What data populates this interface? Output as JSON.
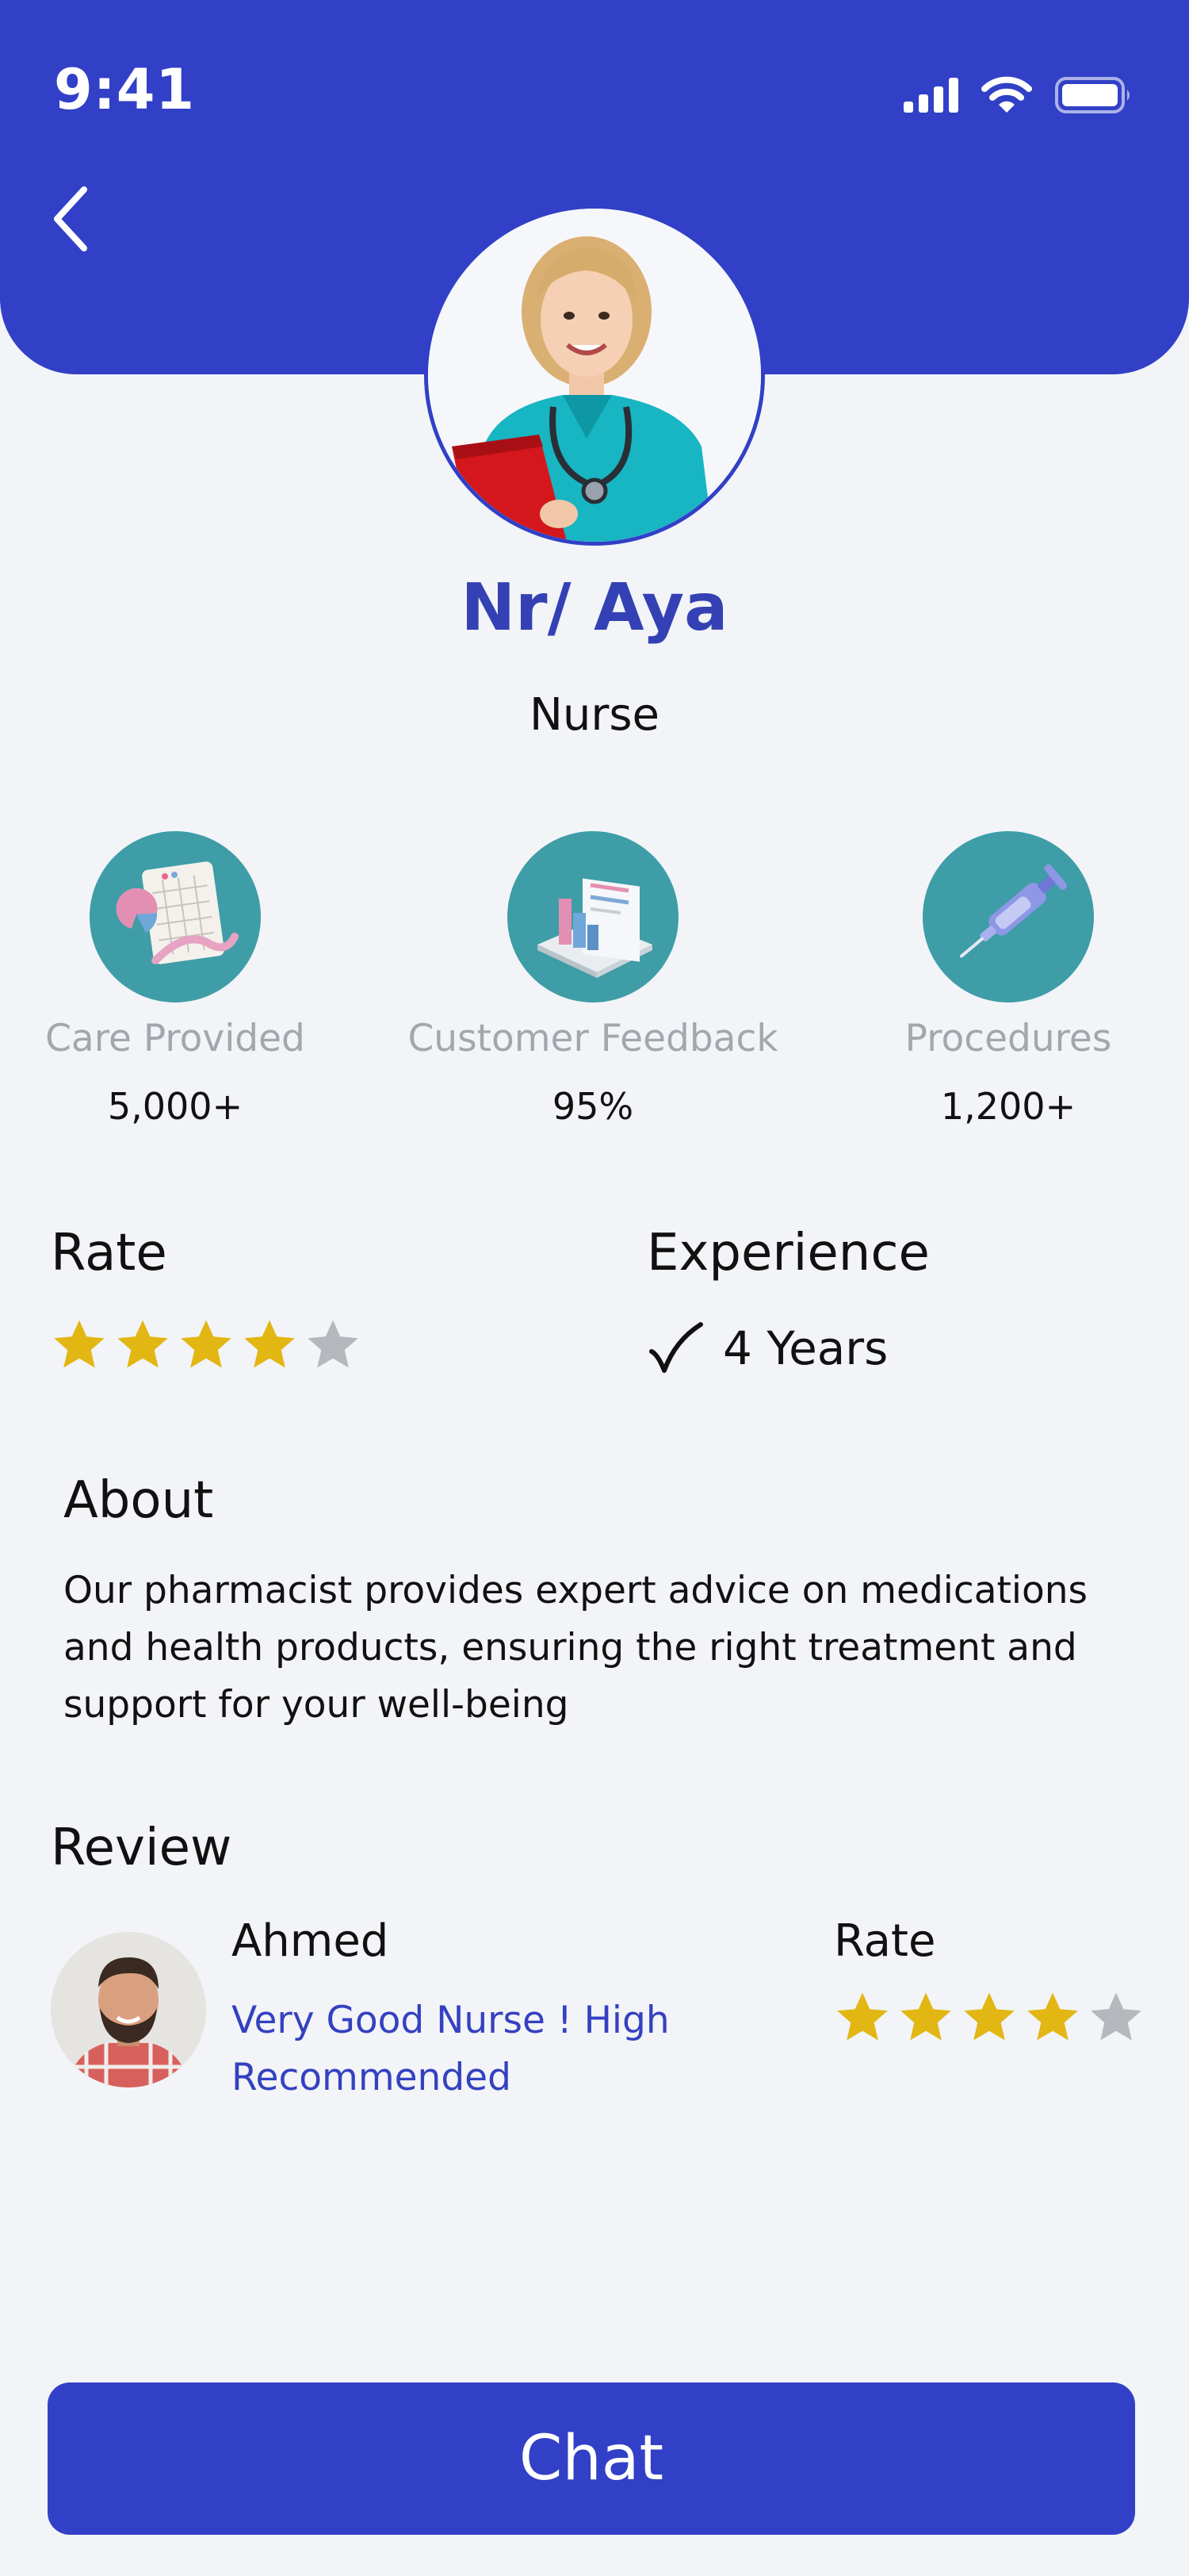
{
  "status_bar": {
    "time": "9:41",
    "icons": [
      "cellular-signal-icon",
      "wifi-icon",
      "battery-icon"
    ]
  },
  "header": {
    "back_icon": "chevron-left-icon"
  },
  "profile": {
    "name": "Nr/ Aya",
    "role": "Nurse",
    "photo": "nurse-photo"
  },
  "stats": [
    {
      "icon": "chart-document-icon",
      "label": "Care Provided",
      "value": "5,000+"
    },
    {
      "icon": "bar-chart-board-icon",
      "label": "Customer Feedback",
      "value": "95%"
    },
    {
      "icon": "syringe-icon",
      "label": "Procedures",
      "value": "1,200+"
    }
  ],
  "rate": {
    "title": "Rate",
    "stars": 4,
    "max_stars": 5
  },
  "experience": {
    "title": "Experience",
    "value": "4 Years",
    "icon": "checkmark-icon"
  },
  "about": {
    "title": "About",
    "text": "Our pharmacist provides expert advice on medications and health products, ensuring the right treatment and support for your well-being"
  },
  "review": {
    "title": "Review",
    "reviewer_name": "Ahmed",
    "comment": "Very Good Nurse ! High Recommended",
    "rate_label": "Rate",
    "stars": 4,
    "max_stars": 5
  },
  "chat_button": {
    "label": "Chat"
  },
  "colors": {
    "primary": "#3140C6",
    "name_text": "#3441B4",
    "stat_circle": "#3E9DA7",
    "star_filled": "#E2B714",
    "star_empty": "#B5B8BC",
    "muted_text": "#A3A7AD",
    "background": "#F2F4F7"
  }
}
